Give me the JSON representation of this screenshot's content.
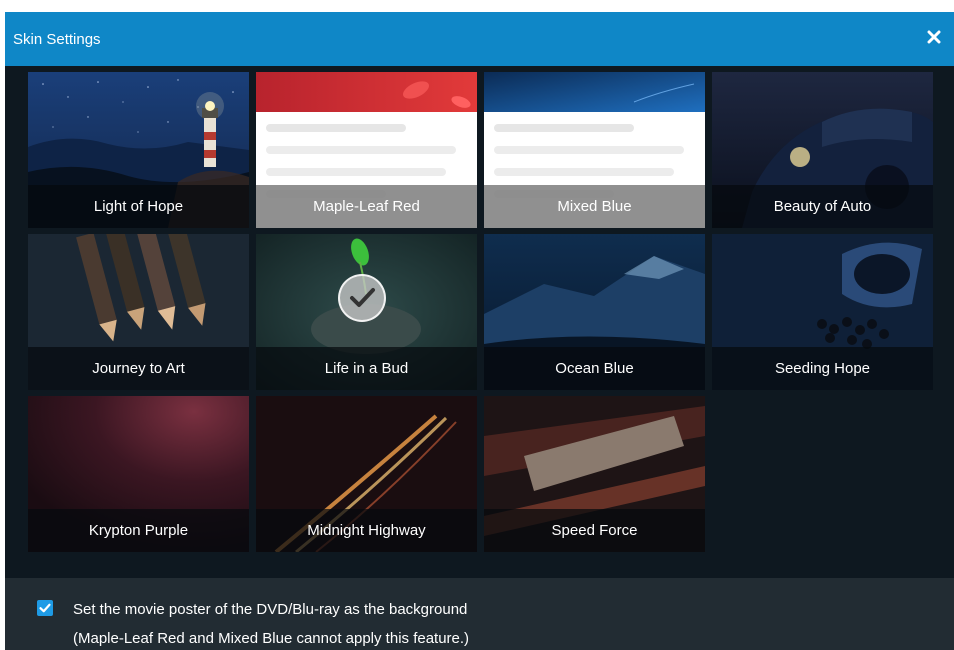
{
  "window": {
    "title": "Skin Settings",
    "close_icon": "close-icon",
    "title_bar_color": "#0f87c7"
  },
  "skins": [
    {
      "name": "Light of Hope"
    },
    {
      "name": "Maple-Leaf Red"
    },
    {
      "name": "Mixed Blue"
    },
    {
      "name": "Beauty of Auto"
    },
    {
      "name": "Journey to Art"
    },
    {
      "name": "Life in a Bud",
      "selected": true
    },
    {
      "name": "Ocean Blue"
    },
    {
      "name": "Seeding Hope"
    },
    {
      "name": "Krypton Purple"
    },
    {
      "name": "Midnight Highway"
    },
    {
      "name": "Speed Force"
    }
  ],
  "footer": {
    "checkbox_checked": true,
    "checkbox_label": "Set the movie poster of the DVD/Blu-ray as the background",
    "note": "(Maple-Leaf Red and Mixed Blue cannot apply this feature.)",
    "accent_color": "#1e9be6"
  }
}
